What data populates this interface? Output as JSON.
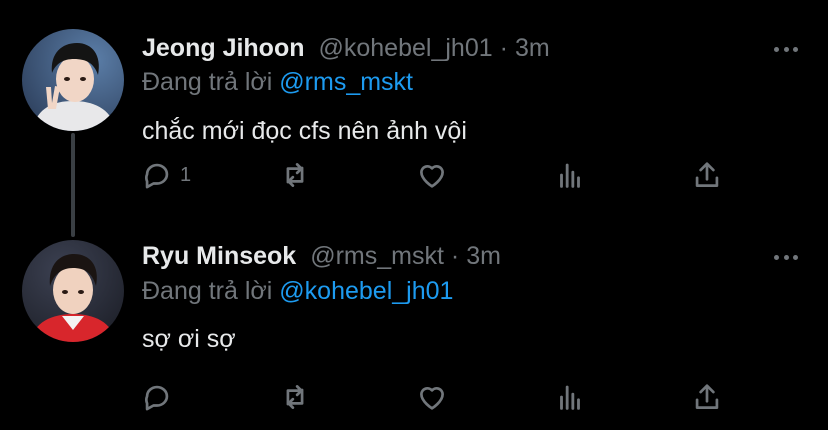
{
  "tweets": [
    {
      "name": "Jeong Jihoon",
      "handle": "@kohebel_jh01",
      "separator": "·",
      "time": "3m",
      "replying_prefix": "Đang trả lời",
      "replying_to": "@rms_mskt",
      "text": "chắc mới đọc cfs nên ảnh vội",
      "reply_count": "1",
      "avatar": "avatar-photo"
    },
    {
      "name": "Ryu Minseok",
      "handle": "@rms_mskt",
      "separator": "·",
      "time": "3m",
      "replying_prefix": "Đang trả lời",
      "replying_to": "@kohebel_jh01",
      "text": "sợ ơi sợ",
      "reply_count": "",
      "avatar": "avatar-photo"
    }
  ],
  "icons": {
    "reply": "reply-icon",
    "retweet": "retweet-icon",
    "like": "like-icon",
    "stats": "stats-icon",
    "share": "share-icon",
    "more": "more-icon"
  },
  "colors": {
    "background": "#000000",
    "text": "#e7e9ea",
    "muted": "#71767b",
    "accent": "#1d9bf0",
    "thread_line": "#3a3f44"
  }
}
